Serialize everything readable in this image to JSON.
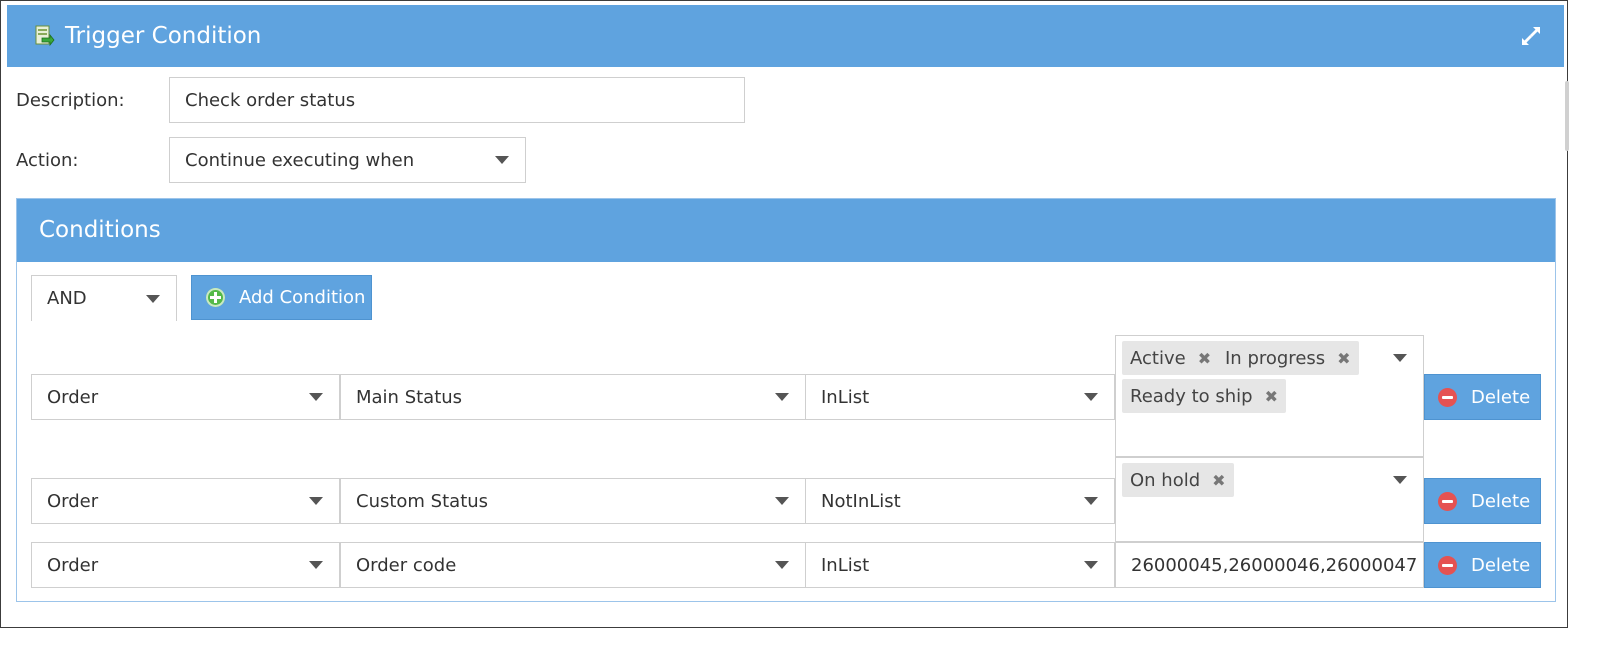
{
  "window": {
    "title": "Trigger Condition",
    "app_icon": "document-arrow-icon",
    "expand_icon": "expand-arrows-icon"
  },
  "form": {
    "description_label": "Description:",
    "description_value": "Check order status",
    "action_label": "Action:",
    "action_value": "Continue executing when"
  },
  "conditions": {
    "header": "Conditions",
    "logic_operator": "AND",
    "add_button_label": "Add Condition",
    "rows": [
      {
        "entity": "Order",
        "field": "Main Status",
        "operator": "InList",
        "values": [
          "Active",
          "In progress",
          "Ready to ship"
        ],
        "delete_label": "Delete"
      },
      {
        "entity": "Order",
        "field": "Custom Status",
        "operator": "NotInList",
        "values": [
          "On hold"
        ],
        "delete_label": "Delete"
      },
      {
        "entity": "Order",
        "field": "Order code",
        "operator": "InList",
        "text_value": "26000045,26000046,26000047",
        "delete_label": "Delete"
      }
    ]
  },
  "colors": {
    "header_blue": "#5fa3df",
    "delete_red": "#e55252",
    "add_green": "#54b948"
  }
}
